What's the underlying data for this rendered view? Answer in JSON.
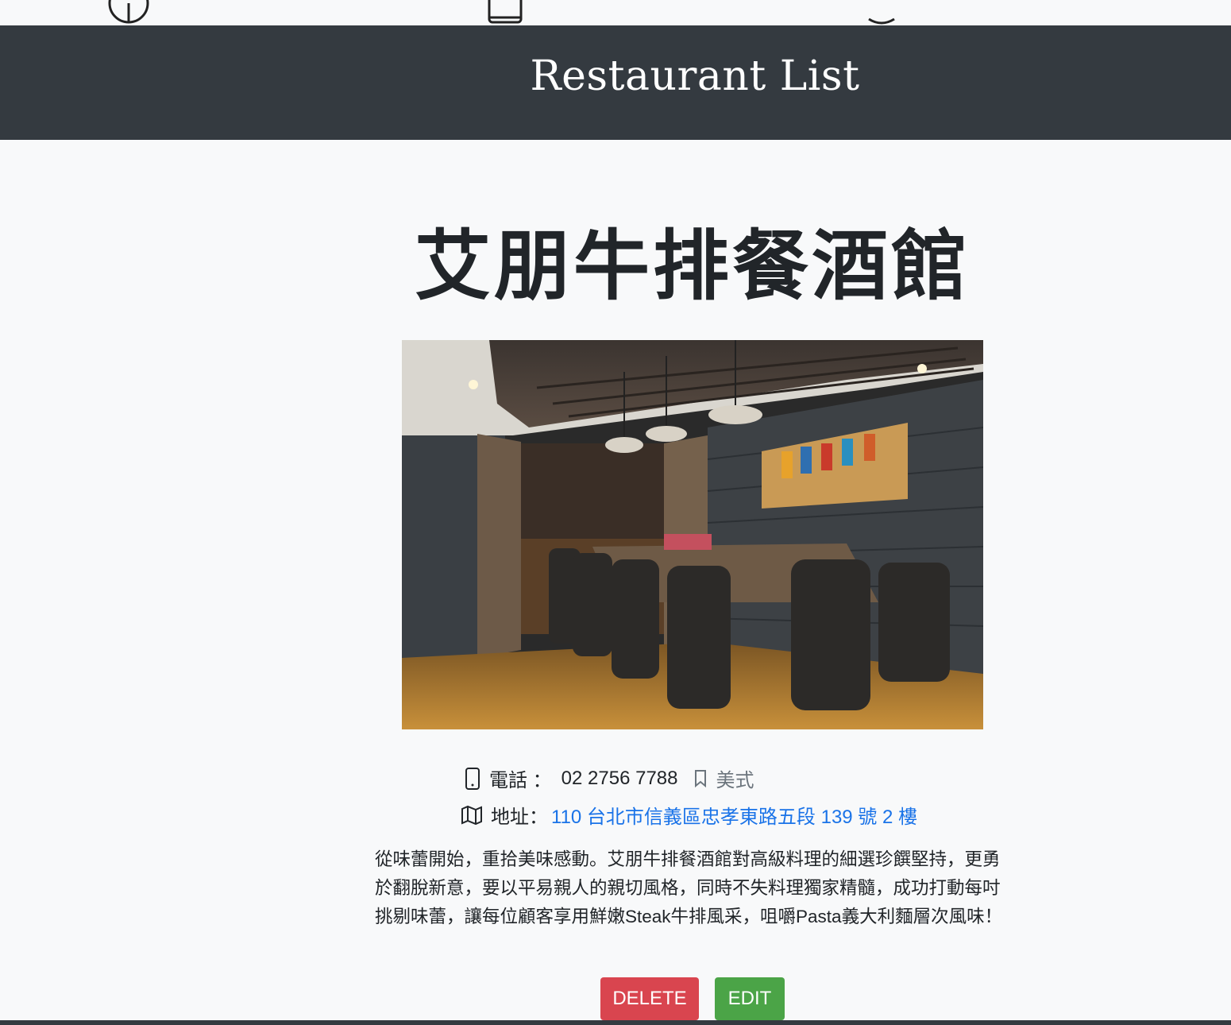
{
  "navbar": {
    "brand": "Restaurant List"
  },
  "restaurant": {
    "name": "艾朋牛排餐酒館",
    "phone_label": "電話 ：",
    "phone": "02 2756 7788",
    "category": "美式",
    "address_label": "地址：",
    "address": "110 台北市信義區忠孝東路五段 139 號 2 樓",
    "description": "從味蕾開始，重拾美味感動。艾朋牛排餐酒館對高級料理的細選珍饌堅持，更勇於翻脫新意，要以平易親人的親切風格，同時不失料理獨家精髓，成功打動每吋挑剔味蕾，讓每位顧客享用鮮嫩Steak牛排風采，咀嚼Pasta義大利麵層次風味！"
  },
  "actions": {
    "delete_label": "DELETE",
    "edit_label": "EDIT"
  },
  "colors": {
    "navbar_bg": "#343a40",
    "page_bg": "#f8f9fa",
    "delete_button": "#d9454f",
    "edit_button": "#4ba447",
    "address_link": "#1a73e8"
  },
  "icons": {
    "phone": "phone-icon",
    "category": "bookmark-icon",
    "address": "map-icon"
  }
}
